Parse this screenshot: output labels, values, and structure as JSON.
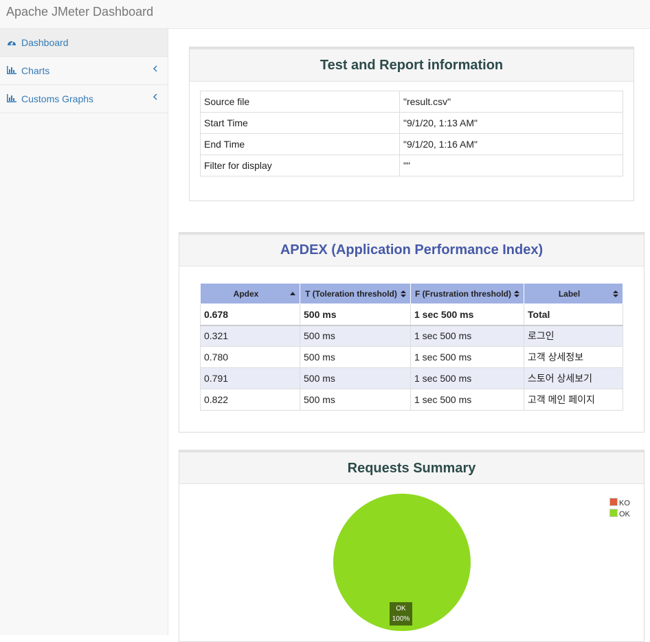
{
  "app": {
    "title": "Apache JMeter Dashboard"
  },
  "sidebar": {
    "items": [
      {
        "label": "Dashboard",
        "icon": "dashboard-icon",
        "active": true
      },
      {
        "label": "Charts",
        "icon": "bar-chart-icon",
        "has_submenu": true
      },
      {
        "label": "Customs Graphs",
        "icon": "bar-chart-icon",
        "has_submenu": true
      }
    ]
  },
  "test_info": {
    "title": "Test and Report information",
    "rows": [
      {
        "label": "Source file",
        "value": "\"result.csv\""
      },
      {
        "label": "Start Time",
        "value": "\"9/1/20, 1:13 AM\""
      },
      {
        "label": "End Time",
        "value": "\"9/1/20, 1:16 AM\""
      },
      {
        "label": "Filter for display",
        "value": "\"\""
      }
    ]
  },
  "apdex": {
    "title": "APDEX (Application Performance Index)",
    "headers": [
      "Apdex",
      "T (Toleration threshold)",
      "F (Frustration threshold)",
      "Label"
    ],
    "total": {
      "apdex": "0.678",
      "t": "500 ms",
      "f": "1 sec 500 ms",
      "label": "Total"
    },
    "rows": [
      {
        "apdex": "0.321",
        "t": "500 ms",
        "f": "1 sec 500 ms",
        "label": "로그인"
      },
      {
        "apdex": "0.780",
        "t": "500 ms",
        "f": "1 sec 500 ms",
        "label": "고객 상세정보"
      },
      {
        "apdex": "0.791",
        "t": "500 ms",
        "f": "1 sec 500 ms",
        "label": "스토어 상세보기"
      },
      {
        "apdex": "0.822",
        "t": "500 ms",
        "f": "1 sec 500 ms",
        "label": "고객 메인 페이지"
      }
    ]
  },
  "requests_summary": {
    "title": "Requests Summary",
    "legend": [
      {
        "name": "KO",
        "color": "#e05c3a"
      },
      {
        "name": "OK",
        "color": "#8fd920"
      }
    ],
    "slice_label": {
      "name": "OK",
      "percent": "100%"
    }
  },
  "chart_data": {
    "type": "pie",
    "title": "Requests Summary",
    "categories": [
      "KO",
      "OK"
    ],
    "values": [
      0,
      100
    ],
    "legend_position": "top-right"
  },
  "colors": {
    "accent": "#337ab7",
    "apdex_title": "#4659a8",
    "header_bg": "#9fb0e3"
  }
}
